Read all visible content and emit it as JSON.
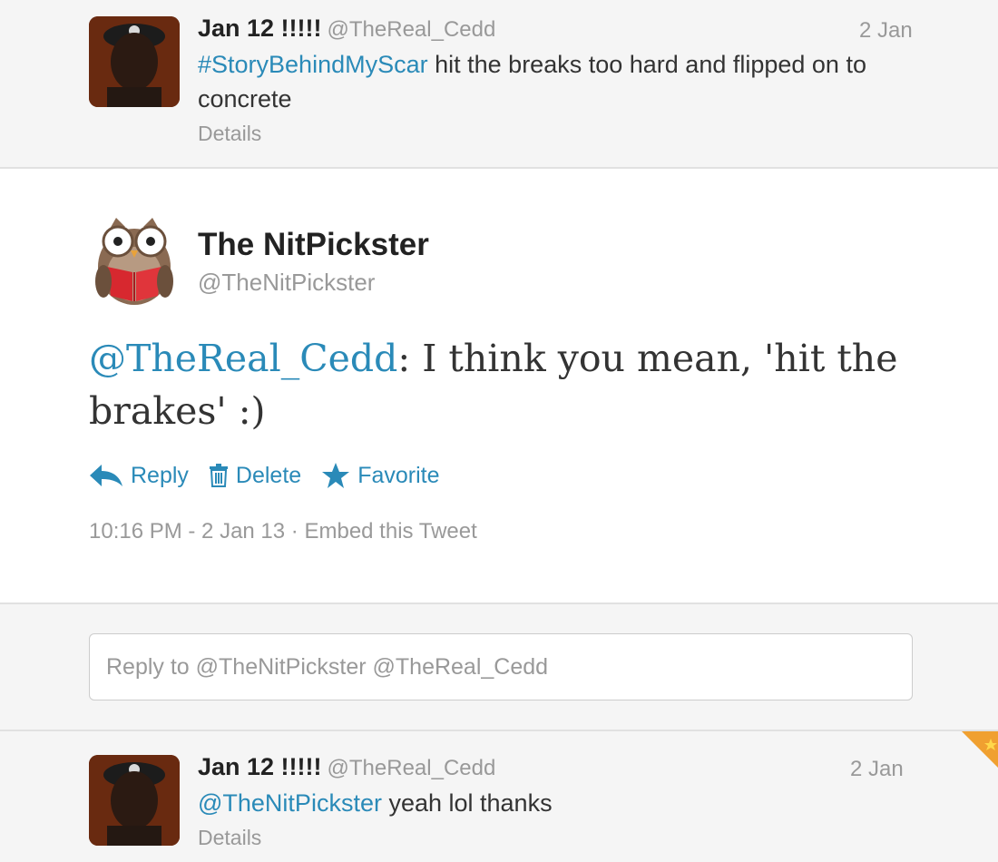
{
  "tweet_top": {
    "name": "Jan 12 !!!!!",
    "handle": "@TheReal_Cedd",
    "time": "2 Jan",
    "hashtag": "#StoryBehindMyScar",
    "text": " hit the breaks too hard and flipped on to concrete",
    "details": "Details"
  },
  "tweet_main": {
    "name": "The NitPickster",
    "handle": "@TheNitPickster",
    "mention": "@TheReal_Cedd",
    "text": ": I think you mean, 'hit the brakes' :)",
    "actions": {
      "reply": "Reply",
      "delete": "Delete",
      "favorite": "Favorite"
    },
    "timestamp": "10:16 PM - 2 Jan 13",
    "separator": " · ",
    "embed": "Embed this Tweet"
  },
  "reply": {
    "placeholder": "Reply to @TheNitPickster @TheReal_Cedd"
  },
  "tweet_bottom": {
    "name": "Jan 12 !!!!!",
    "handle": "@TheReal_Cedd",
    "time": "2 Jan",
    "mention": "@TheNitPickster",
    "text": " yeah lol thanks",
    "details": "Details"
  },
  "colors": {
    "link": "#2a8ab8",
    "muted": "#999999",
    "text": "#333333"
  }
}
